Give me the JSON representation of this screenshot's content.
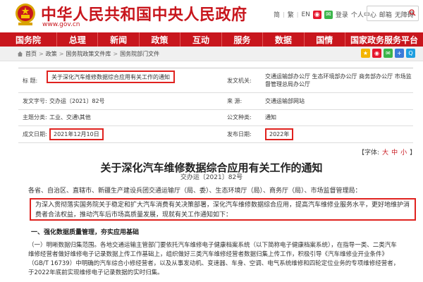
{
  "header": {
    "site_title": "中华人民共和国中央人民政府",
    "site_domain": "www.gov.cn",
    "links": [
      "简",
      "繁",
      "EN",
      "登录",
      "个人中心",
      "邮箱",
      "无障碍"
    ],
    "search_placeholder": "",
    "brand_color": "#c8161d"
  },
  "nav": {
    "items": [
      "国务院",
      "总理",
      "新闻",
      "政策",
      "互动",
      "服务",
      "数据",
      "国情",
      "国家政务服务平台"
    ]
  },
  "breadcrumb": {
    "items": [
      "首页",
      "政策",
      "国务院政策文件库",
      "国务院部门文件"
    ]
  },
  "meta": {
    "title_label": "标 题:",
    "title_value": "关于深化汽车维修数据综合应用有关工作的通知",
    "issuer_label": "发文机关:",
    "issuer_value": "交通运输部办公厅 生态环境部办公厅 商务部办公厅 市场监督管理总局办公厅",
    "docno_label": "发文字号:",
    "docno_value": "交办运〔2021〕82号",
    "source_label": "来 源:",
    "source_value": "交通运输部网站",
    "topic_label": "主题分类:",
    "topic_value": "工业、交通\\其他",
    "type_label": "公文种类:",
    "type_value": "通知",
    "date_label": "成文日期:",
    "date_value": "2021年12月10日",
    "pub_label": "发布日期:",
    "pub_value": "2022年"
  },
  "fontsize": {
    "label": "【字体:",
    "big": "大",
    "mid": "中",
    "small": "小",
    "close": "】"
  },
  "article": {
    "title": "关于深化汽车维修数据综合应用有关工作的通知",
    "doc_number": "交办运〔2021〕82号",
    "salutation": "各省、自治区、直辖市、新疆生产建设兵团交通运输厅（局、委）、生态环境厅（局）、商务厅（局）、市场监督管理局：",
    "intro": "为深入贯彻落实国务院关于稳定和扩大汽车消费有关决策部署，深化汽车维修数据综合应用，提高汽车维修业服务水平，更好地维护消费者合法权益，推动汽车后市场高质量发展，现就有关工作通知如下：",
    "section_heading": "一、强化数据质量管理，夯实应用基础",
    "paragraph": "（一）明晰数据归集范围。各地交通运输主管部门要依托汽车维修电子健康档案系统（以下简称电子健康档案系统），在指导一类、二类汽车维修经营者做好维修电子记录数据上传工作基础上，组织做好三类汽车维修经营者数据归集上传工作，积极引导《汽车维修业开业条件》（GB/T 16739）中明确的汽车综合小修经营者，以及从事发动机、变速器、车身、空调、电气系统维修和四轮定位业务的专项维修经营者，于2022年底前实现维修电子记录数据的实时归集。"
  }
}
